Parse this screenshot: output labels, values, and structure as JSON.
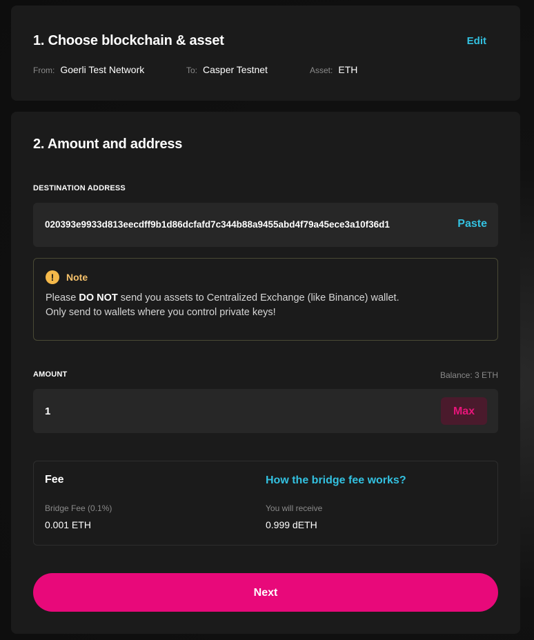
{
  "step1": {
    "title": "1. Choose blockchain & asset",
    "edit_label": "Edit",
    "from_label": "From:",
    "from_value": "Goerli Test Network",
    "to_label": "To:",
    "to_value": "Casper Testnet",
    "asset_label": "Asset:",
    "asset_value": "ETH"
  },
  "step2": {
    "title": "2. Amount and address",
    "destination": {
      "label": "DESTINATION ADDRESS",
      "value": "020393e9933d813eecdff9b1d86dcfafd7c344b88a9455abd4f79a45ece3a10f36d1",
      "paste_label": "Paste"
    },
    "note": {
      "icon": "warning-icon",
      "icon_glyph": "!",
      "title": "Note",
      "line1_prefix": "Please ",
      "line1_bold": "DO NOT",
      "line1_suffix": " send you assets to Centralized Exchange (like Binance) wallet.",
      "line2": "Only send to wallets where you control private keys!"
    },
    "amount": {
      "label": "AMOUNT",
      "balance": "Balance: 3 ETH",
      "value": "1",
      "max_label": "Max"
    },
    "fee": {
      "title": "Fee",
      "link": "How the bridge fee works?",
      "bridge_fee_label": "Bridge Fee (0.1%)",
      "bridge_fee_value": "0.001 ETH",
      "receive_label": "You will receive",
      "receive_value": "0.999 dETH"
    },
    "next_label": "Next"
  },
  "colors": {
    "accent_pink": "#e8097a",
    "accent_cyan": "#33c1e0",
    "warning": "#f5b94a",
    "card_bg": "#1b1b1b",
    "input_bg": "#272727"
  }
}
